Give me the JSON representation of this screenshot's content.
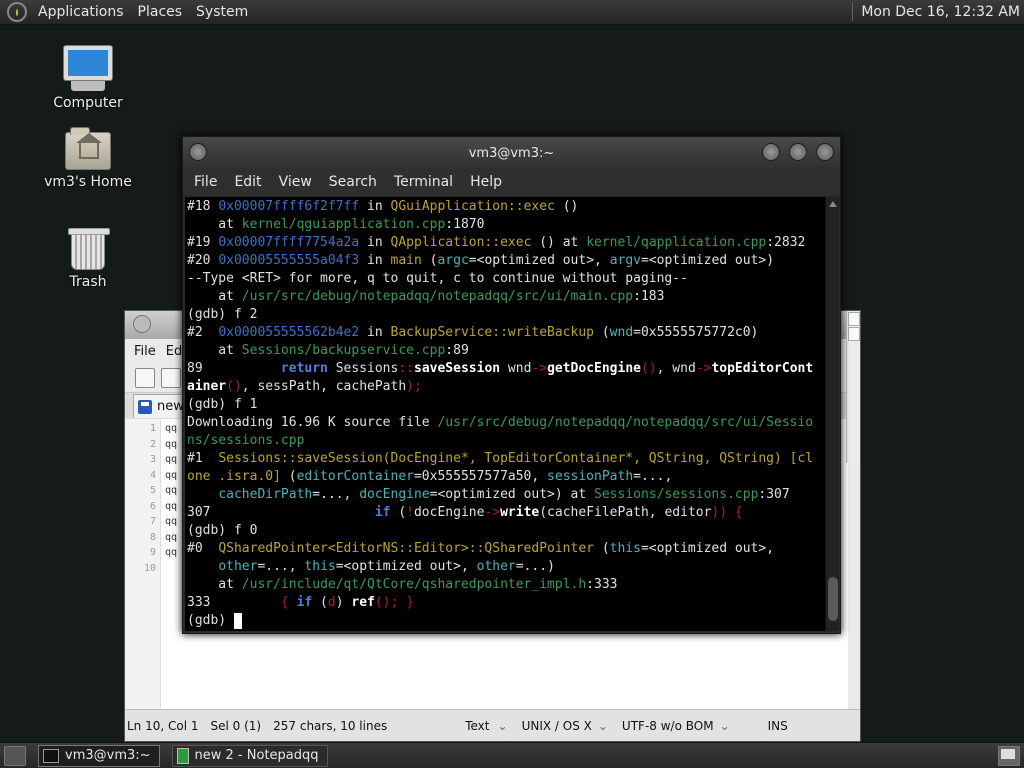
{
  "top_panel": {
    "menus": [
      "Applications",
      "Places",
      "System"
    ],
    "clock": "Mon Dec 16, 12:32 AM"
  },
  "desktop_icons": [
    {
      "label": "Computer",
      "icon": "computer-icon"
    },
    {
      "label": "vm3's Home",
      "icon": "home-folder-icon"
    },
    {
      "label": "Trash",
      "icon": "trash-icon"
    }
  ],
  "terminal": {
    "title": "vm3@vm3:~",
    "menus": [
      "File",
      "Edit",
      "View",
      "Search",
      "Terminal",
      "Help"
    ]
  },
  "notepad": {
    "menu_first": "File",
    "menu_second": "Ed",
    "tab_label": "new",
    "line_numbers": [
      "1",
      "2",
      "3",
      "4",
      "5",
      "6",
      "7",
      "8",
      "9",
      "10"
    ],
    "lines": [
      "qq",
      "qq",
      "qq",
      "qq",
      "qq",
      "qq",
      "qq",
      "qq",
      "qq",
      ""
    ],
    "status": {
      "position": "Ln 10, Col 1",
      "selection": "Sel 0 (1)",
      "stats": "257 chars, 10 lines",
      "language": "Text",
      "eol": "UNIX / OS X",
      "encoding": "UTF-8 w/o BOM",
      "mode": "INS"
    }
  },
  "taskbar": {
    "tasks": [
      {
        "label": "vm3@vm3:~",
        "active": true
      },
      {
        "label": "new 2 - Notepadqq",
        "active": false
      }
    ]
  },
  "colors": {
    "desktop_bg": "#151b19",
    "terminal_bg": "#000000",
    "address_blue": "#3f72c6",
    "path_green": "#3a9a5c",
    "function_yellow": "#b8a436",
    "keyword_blue": "#4f7fd6"
  },
  "gdb_output": [
    [
      [
        "#18 ",
        ""
      ],
      [
        "0x00007ffff6f2f7ff",
        "blu"
      ],
      [
        " in ",
        ""
      ],
      [
        "QGuiApplication::exec",
        "yel"
      ],
      [
        " ()",
        ""
      ]
    ],
    [
      [
        "    at ",
        ""
      ],
      [
        "kernel/qguiapplication.cpp",
        "grn"
      ],
      [
        ":1870",
        ""
      ]
    ],
    [
      [
        "#19 ",
        ""
      ],
      [
        "0x00007ffff7754a2a",
        "blu"
      ],
      [
        " in ",
        ""
      ],
      [
        "QApplication::exec",
        "yel"
      ],
      [
        " () at ",
        ""
      ],
      [
        "kernel/qapplication.cpp",
        "grn"
      ],
      [
        ":2832",
        ""
      ]
    ],
    [
      [
        "#20 ",
        ""
      ],
      [
        "0x00005555555a04f3",
        "blu"
      ],
      [
        " in ",
        ""
      ],
      [
        "main",
        "yel"
      ],
      [
        " (",
        ""
      ],
      [
        "argc",
        "cyan"
      ],
      [
        "=<optimized out>, ",
        ""
      ],
      [
        "argv",
        "cyan"
      ],
      [
        "=<optimized out>)",
        ""
      ]
    ],
    [
      [
        "--Type <RET> for more, q to quit, c to continue without paging--",
        ""
      ]
    ],
    [
      [
        "    at ",
        ""
      ],
      [
        "/usr/src/debug/notepadqq/notepadqq/src/ui/main.cpp",
        "grn"
      ],
      [
        ":183",
        ""
      ]
    ],
    [
      [
        "(gdb) f 2",
        ""
      ]
    ],
    [
      [
        "#2  ",
        ""
      ],
      [
        "0x000055555562b4e2",
        "blu"
      ],
      [
        " in ",
        ""
      ],
      [
        "BackupService::writeBackup",
        "yel"
      ],
      [
        " (",
        ""
      ],
      [
        "wnd",
        "cyan"
      ],
      [
        "=0x5555575772c0)",
        ""
      ]
    ],
    [
      [
        "    at ",
        ""
      ],
      [
        "Sessions/backupservice.cpp",
        "grn"
      ],
      [
        ":89",
        ""
      ]
    ],
    [
      [
        "89          ",
        ""
      ],
      [
        "return",
        "bb"
      ],
      [
        " Sessions",
        ""
      ],
      [
        "::",
        "red"
      ],
      [
        "saveSession",
        "wb"
      ],
      [
        " wnd",
        ""
      ],
      [
        "->",
        "red"
      ],
      [
        "getDocEngine",
        "wb"
      ],
      [
        "()",
        "red"
      ],
      [
        ", wnd",
        ""
      ],
      [
        "->",
        "red"
      ],
      [
        "topEditorCont",
        "wb"
      ]
    ],
    [
      [
        "ainer",
        "wb"
      ],
      [
        "()",
        "red"
      ],
      [
        ", sessPath, cachePath",
        ""
      ],
      [
        ");",
        "red"
      ]
    ],
    [
      [
        "(gdb) f 1",
        ""
      ]
    ],
    [
      [
        "Downloading 16.96 K source file ",
        ""
      ],
      [
        "/usr/src/debug/notepadqq/notepadqq/src/ui/Sessio",
        "grn"
      ]
    ],
    [
      [
        "ns/sessions.cpp",
        "grn"
      ]
    ],
    [
      [
        "#1  ",
        ""
      ],
      [
        "Sessions::saveSession(DocEngine*, TopEditorContainer*, QString, QString) [cl",
        "yel"
      ]
    ],
    [
      [
        "one .isra.0]",
        "yel"
      ],
      [
        " (",
        ""
      ],
      [
        "editorContainer",
        "cyan"
      ],
      [
        "=0x555557577a50, ",
        ""
      ],
      [
        "sessionPath",
        "cyan"
      ],
      [
        "=...,",
        ""
      ]
    ],
    [
      [
        "    ",
        ""
      ],
      [
        "cacheDirPath",
        "cyan"
      ],
      [
        "=..., ",
        ""
      ],
      [
        "docEngine",
        "cyan"
      ],
      [
        "=<optimized out>) at ",
        ""
      ],
      [
        "Sessions/sessions.cpp",
        "grn"
      ],
      [
        ":307",
        ""
      ]
    ],
    [
      [
        "307                     ",
        ""
      ],
      [
        "if",
        "bb"
      ],
      [
        " (",
        ""
      ],
      [
        "!",
        "red"
      ],
      [
        "docEngine",
        ""
      ],
      [
        "->",
        "red"
      ],
      [
        "write",
        "wb"
      ],
      [
        "(cacheFilePath, editor",
        ""
      ],
      [
        ")) {",
        "red"
      ]
    ],
    [
      [
        "(gdb) f 0",
        ""
      ]
    ],
    [
      [
        "#0  ",
        ""
      ],
      [
        "QSharedPointer<EditorNS::Editor>::QSharedPointer",
        "yel"
      ],
      [
        " (",
        ""
      ],
      [
        "this",
        "cyan"
      ],
      [
        "=<optimized out>,",
        ""
      ]
    ],
    [
      [
        "    ",
        ""
      ],
      [
        "other",
        "cyan"
      ],
      [
        "=..., ",
        ""
      ],
      [
        "this",
        "cyan"
      ],
      [
        "=<optimized out>, ",
        ""
      ],
      [
        "other",
        "cyan"
      ],
      [
        "=...)",
        ""
      ]
    ],
    [
      [
        "    at ",
        ""
      ],
      [
        "/usr/include/qt/QtCore/qsharedpointer_impl.h",
        "grn"
      ],
      [
        ":333",
        ""
      ]
    ],
    [
      [
        "333         ",
        ""
      ],
      [
        "{ ",
        "red"
      ],
      [
        "if",
        "bb"
      ],
      [
        " (",
        ""
      ],
      [
        "d",
        "red"
      ],
      [
        ") ",
        ""
      ],
      [
        "ref",
        "wb"
      ],
      [
        "(); }",
        "red"
      ]
    ],
    [
      [
        "(gdb) ",
        ""
      ]
    ]
  ]
}
